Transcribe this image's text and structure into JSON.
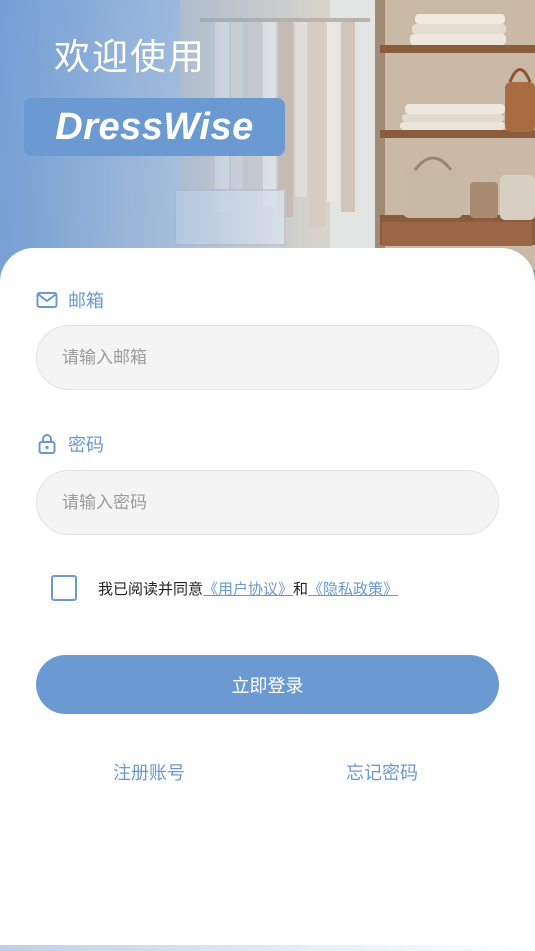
{
  "header": {
    "welcome": "欢迎使用",
    "brand": "DressWise"
  },
  "form": {
    "email": {
      "label": "邮箱",
      "placeholder": "请输入邮箱",
      "value": ""
    },
    "password": {
      "label": "密码",
      "placeholder": "请输入密码",
      "value": ""
    },
    "agreement": {
      "prefix": "我已阅读并同意",
      "user_agreement": "《用户协议》",
      "and": "和",
      "privacy_policy": "《隐私政策》",
      "checked": false
    },
    "login_button": "立即登录"
  },
  "footer": {
    "register": "注册账号",
    "forgot": "忘记密码"
  },
  "colors": {
    "accent": "#6b9ad3",
    "link": "#6a98cf",
    "input_bg": "#f4f4f4"
  }
}
